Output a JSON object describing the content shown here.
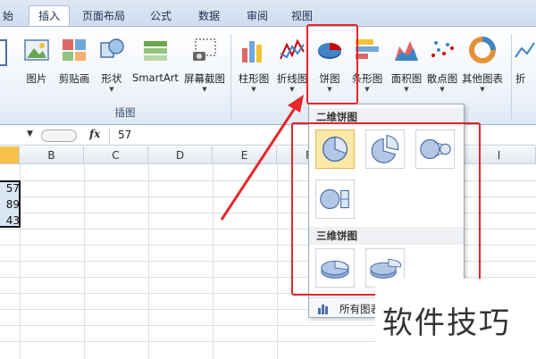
{
  "tabs": [
    {
      "label": "始",
      "active": false
    },
    {
      "label": "插入",
      "active": true
    },
    {
      "label": "页面布局",
      "active": false
    },
    {
      "label": "公式",
      "active": false
    },
    {
      "label": "数据",
      "active": false
    },
    {
      "label": "审阅",
      "active": false
    },
    {
      "label": "视图",
      "active": false
    }
  ],
  "ribbon": {
    "illustrations": {
      "group_label": "插图",
      "buttons": [
        {
          "label": "图片",
          "icon": "picture-icon"
        },
        {
          "label": "剪贴画",
          "icon": "clipart-icon"
        },
        {
          "label": "形状",
          "icon": "shapes-icon"
        },
        {
          "label": "SmartArt",
          "icon": "smartart-icon"
        },
        {
          "label": "屏幕截图",
          "icon": "screenshot-icon"
        }
      ]
    },
    "charts": {
      "buttons": [
        {
          "label": "柱形图",
          "icon": "column-chart-icon"
        },
        {
          "label": "折线图",
          "icon": "line-chart-icon"
        },
        {
          "label": "饼图",
          "icon": "pie-chart-icon"
        },
        {
          "label": "条形图",
          "icon": "bar-chart-icon"
        },
        {
          "label": "面积图",
          "icon": "area-chart-icon"
        },
        {
          "label": "散点图",
          "icon": "scatter-chart-icon"
        },
        {
          "label": "其他图表",
          "icon": "other-charts-icon"
        }
      ],
      "partial_label": "折"
    }
  },
  "formula_bar": {
    "fx": "fx",
    "value": "57"
  },
  "columns": [
    "B",
    "C",
    "D",
    "E",
    "F",
    "I"
  ],
  "cells": [
    "57",
    "89",
    "43"
  ],
  "pie_dropdown": {
    "section_2d": "二维饼图",
    "section_3d": "三维饼图",
    "all_charts_label": "所有图表"
  },
  "watermark": "软件技巧",
  "colors": {
    "accent_red": "#e6262a",
    "selected": "#ffe9a8"
  }
}
